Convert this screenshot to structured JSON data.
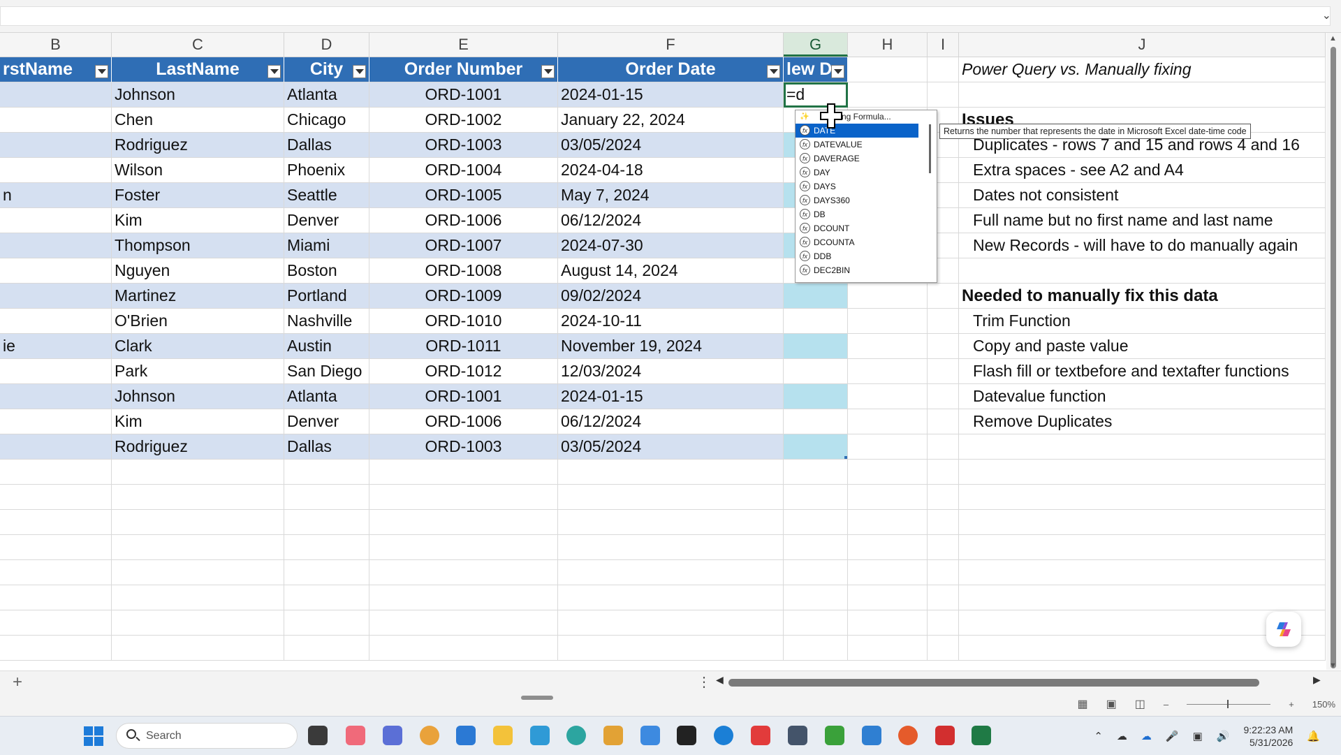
{
  "columns": [
    "B",
    "C",
    "D",
    "E",
    "F",
    "G",
    "H",
    "I",
    "J"
  ],
  "active_column": "G",
  "table_headers": [
    "rstName",
    "LastName",
    "City",
    "Order Number",
    "Order Date",
    "lew Da"
  ],
  "rows": [
    {
      "b": "",
      "c": "Johnson",
      "d": "Atlanta",
      "e": "ORD-1001",
      "f": "2024-01-15",
      "g": "=d"
    },
    {
      "b": "",
      "c": "Chen",
      "d": "Chicago",
      "e": "ORD-1002",
      "f": "January 22, 2024",
      "g": ""
    },
    {
      "b": "",
      "c": "Rodriguez",
      "d": "Dallas",
      "e": "ORD-1003",
      "f": "03/05/2024",
      "g": ""
    },
    {
      "b": "",
      "c": "Wilson",
      "d": "Phoenix",
      "e": "ORD-1004",
      "f": "2024-04-18",
      "g": ""
    },
    {
      "b": "n",
      "c": "Foster",
      "d": "Seattle",
      "e": "ORD-1005",
      "f": "May 7, 2024",
      "g": ""
    },
    {
      "b": "",
      "c": "Kim",
      "d": "Denver",
      "e": "ORD-1006",
      "f": "06/12/2024",
      "g": ""
    },
    {
      "b": "",
      "c": "Thompson",
      "d": "Miami",
      "e": "ORD-1007",
      "f": "2024-07-30",
      "g": ""
    },
    {
      "b": "",
      "c": "Nguyen",
      "d": "Boston",
      "e": "ORD-1008",
      "f": "August 14, 2024",
      "g": ""
    },
    {
      "b": "",
      "c": "Martinez",
      "d": "Portland",
      "e": "ORD-1009",
      "f": "09/02/2024",
      "g": ""
    },
    {
      "b": "",
      "c": "O'Brien",
      "d": "Nashville",
      "e": "ORD-1010",
      "f": "2024-10-11",
      "g": ""
    },
    {
      "b": "ie",
      "c": "Clark",
      "d": "Austin",
      "e": "ORD-1011",
      "f": "November 19, 2024",
      "g": ""
    },
    {
      "b": "",
      "c": "Park",
      "d": "San Diego",
      "e": "ORD-1012",
      "f": "12/03/2024",
      "g": ""
    },
    {
      "b": "",
      "c": "Johnson",
      "d": "Atlanta",
      "e": "ORD-1001",
      "f": "2024-01-15",
      "g": ""
    },
    {
      "b": "",
      "c": "Kim",
      "d": "Denver",
      "e": "ORD-1006",
      "f": "06/12/2024",
      "g": ""
    },
    {
      "b": "",
      "c": "Rodriguez",
      "d": "Dallas",
      "e": "ORD-1003",
      "f": "03/05/2024",
      "g": ""
    }
  ],
  "notes": {
    "title": "Power Query vs. Manually fixing",
    "issues_heading": "Issues",
    "issues": [
      "Duplicates - rows 7 and 15 and rows 4 and 16",
      "Extra spaces - see A2 and A4",
      "Dates not consistent",
      "Full name but no first name and last name",
      "New Records - will have to do manually again"
    ],
    "manual_heading": "Needed to manually fix this data",
    "manual": [
      "Trim Function",
      "Copy and paste value",
      "Flash fill or textbefore and textafter functions",
      "Datevalue function",
      "Remove Duplicates"
    ]
  },
  "autocomplete": {
    "header": "ting Formula...",
    "items": [
      "DATE",
      "DATEVALUE",
      "DAVERAGE",
      "DAY",
      "DAYS",
      "DAYS360",
      "DB",
      "DCOUNT",
      "DCOUNTA",
      "DDB",
      "DEC2BIN"
    ],
    "selected": "DATE",
    "tooltip": "Returns the number that represents the date in Microsoft Excel date-time code"
  },
  "status": {
    "zoom": "150%"
  },
  "taskbar": {
    "search_placeholder": "Search",
    "time": "9:22:23 AM",
    "date": "5/31/2026"
  },
  "colors": {
    "header_blue": "#2f6eb5",
    "band": "#d5e0f1",
    "g_band": "#b6e1ee",
    "accent_green": "#217346"
  }
}
